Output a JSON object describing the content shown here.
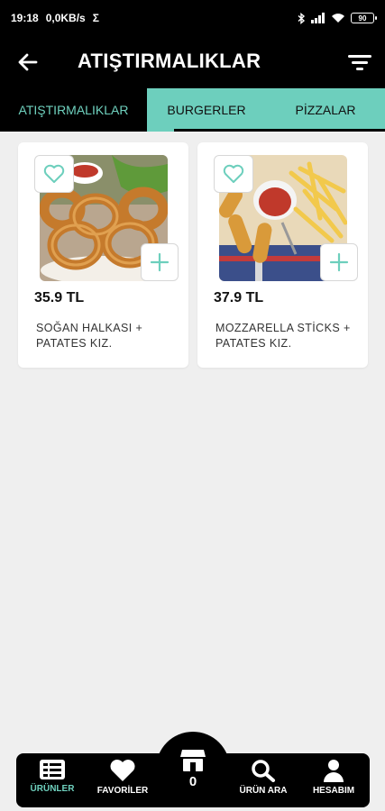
{
  "status_bar": {
    "time": "19:18",
    "network_speed": "0,0KB/s",
    "sigma": "Σ",
    "battery": "90"
  },
  "app_bar": {
    "title": "ATIŞTIRMALIKLAR",
    "back_icon": "arrow-left-icon",
    "filter_icon": "filter-icon"
  },
  "tabs": [
    {
      "label": "ATIŞTIRMALIKLAR",
      "active": true
    },
    {
      "label": "BURGERLER",
      "active": false
    },
    {
      "label": "PİZZALAR",
      "active": false
    }
  ],
  "products": [
    {
      "price": "35.9 TL",
      "name": "SOĞAN HALKASI + PATATES KIZ.",
      "image": "onion-rings-photo"
    },
    {
      "price": "37.9 TL",
      "name": "MOZZARELLA STİCKS + PATATES KIZ.",
      "image": "mozzarella-sticks-photo"
    }
  ],
  "bottom_nav": {
    "items": [
      {
        "label": "ÜRÜNLER",
        "icon": "list-icon",
        "active": true
      },
      {
        "label": "FAVORİLER",
        "icon": "heart-icon",
        "active": false
      },
      {
        "label": "ÜRÜN ARA",
        "icon": "search-icon",
        "active": false
      },
      {
        "label": "HESABIM",
        "icon": "person-icon",
        "active": false
      }
    ],
    "cart_count": "0",
    "cart_icon": "store-icon"
  },
  "colors": {
    "accent": "#6dcfbd",
    "background": "#efefef",
    "dark": "#000000"
  }
}
